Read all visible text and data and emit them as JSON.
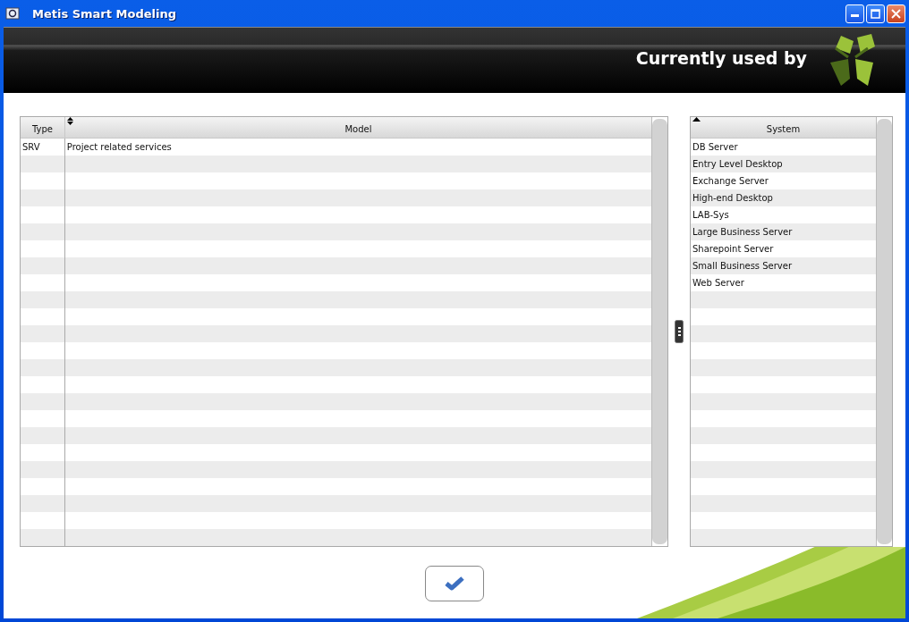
{
  "window": {
    "title": "Metis Smart Modeling"
  },
  "header": {
    "title": "Currently used by"
  },
  "models_table": {
    "columns": [
      {
        "label": "Type",
        "sortable": false,
        "sorted": false
      },
      {
        "label": "Model",
        "sortable": true,
        "sorted": false
      }
    ],
    "rows": [
      {
        "type": "SRV",
        "model": "Project related services"
      }
    ]
  },
  "systems_table": {
    "columns": [
      {
        "label": "System",
        "sortable": true,
        "sorted": true
      }
    ],
    "rows": [
      {
        "system": "DB Server"
      },
      {
        "system": "Entry Level Desktop"
      },
      {
        "system": "Exchange Server"
      },
      {
        "system": "High-end Desktop"
      },
      {
        "system": "LAB-Sys"
      },
      {
        "system": "Large Business Server"
      },
      {
        "system": "Sharepoint Server"
      },
      {
        "system": "Small Business Server"
      },
      {
        "system": "Web Server"
      }
    ]
  }
}
